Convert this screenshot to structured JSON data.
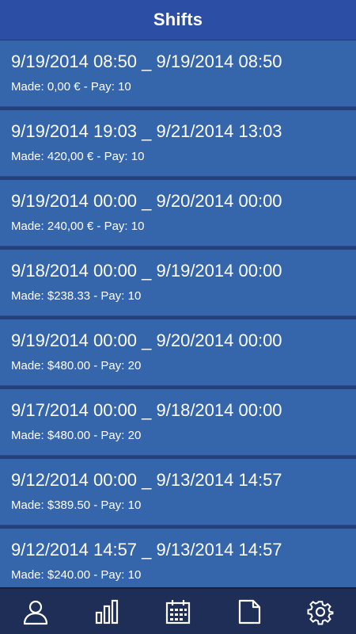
{
  "header": {
    "title": "Shifts"
  },
  "shifts": [
    {
      "range": "9/19/2014 08:50 _ 9/19/2014 08:50",
      "made": "0,00 €",
      "pay": "10"
    },
    {
      "range": "9/19/2014 19:03 _ 9/21/2014 13:03",
      "made": "420,00 €",
      "pay": "10"
    },
    {
      "range": "9/19/2014 00:00 _ 9/20/2014 00:00",
      "made": "240,00 €",
      "pay": "10"
    },
    {
      "range": "9/18/2014 00:00 _ 9/19/2014 00:00",
      "made": "$238.33",
      "pay": "10"
    },
    {
      "range": "9/19/2014 00:00 _ 9/20/2014 00:00",
      "made": "$480.00",
      "pay": "20"
    },
    {
      "range": "9/17/2014 00:00 _ 9/18/2014 00:00",
      "made": "$480.00",
      "pay": "20"
    },
    {
      "range": "9/12/2014 00:00 _ 9/13/2014 14:57",
      "made": "$389.50",
      "pay": "10"
    },
    {
      "range": "9/12/2014 14:57 _ 9/13/2014 14:57",
      "made": "$240.00",
      "pay": "10"
    }
  ],
  "labels": {
    "made": "Made: ",
    "pay": " - Pay: "
  },
  "tabbar": {
    "tabs": [
      {
        "icon": "person-icon"
      },
      {
        "icon": "bar-chart-icon"
      },
      {
        "icon": "calendar-icon"
      },
      {
        "icon": "document-icon"
      },
      {
        "icon": "gear-icon"
      }
    ]
  },
  "colors": {
    "header_bg": "#2d4ea5",
    "row_bg": "#3565aa",
    "tabbar_bg": "#1e2e57",
    "text": "#ffffff"
  }
}
